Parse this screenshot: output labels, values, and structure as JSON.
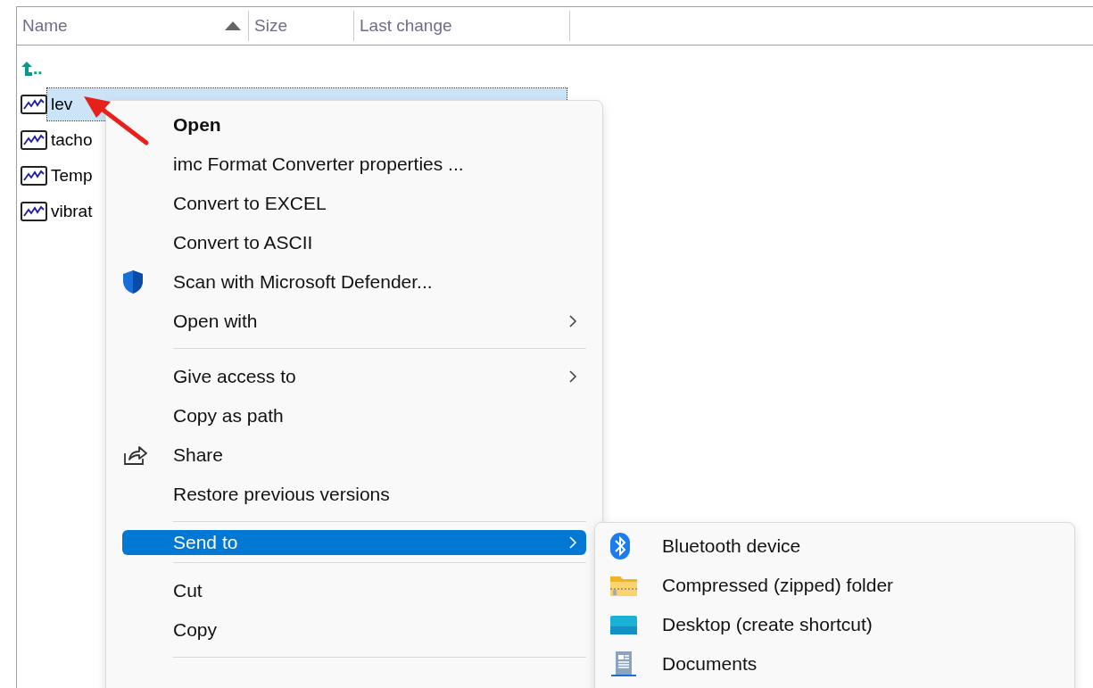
{
  "file_list": {
    "columns": [
      {
        "label": "Name",
        "sorted": true
      },
      {
        "label": "Size",
        "sorted": false
      },
      {
        "label": "Last change",
        "sorted": false
      }
    ],
    "rows": [
      {
        "kind": "parent",
        "name": ".."
      },
      {
        "kind": "file",
        "name": "lev",
        "selected": true
      },
      {
        "kind": "file",
        "name": "tacho",
        "selected": false
      },
      {
        "kind": "file",
        "name": "Temp",
        "selected": false
      },
      {
        "kind": "file",
        "name": "vibrat",
        "selected": false
      }
    ]
  },
  "context_menu": {
    "items": [
      {
        "kind": "item",
        "label": "Open",
        "bold": true,
        "submenu": false,
        "selected": false
      },
      {
        "kind": "item",
        "label": "imc Format Converter properties ...",
        "bold": false,
        "submenu": false,
        "selected": false
      },
      {
        "kind": "item",
        "label": "Convert to EXCEL",
        "bold": false,
        "submenu": false,
        "selected": false
      },
      {
        "kind": "item",
        "label": "Convert to ASCII",
        "bold": false,
        "submenu": false,
        "selected": false
      },
      {
        "kind": "item",
        "label": "Scan with Microsoft Defender...",
        "bold": false,
        "submenu": false,
        "selected": false
      },
      {
        "kind": "item",
        "label": "Open with",
        "bold": false,
        "submenu": true,
        "selected": false
      },
      {
        "kind": "separator"
      },
      {
        "kind": "item",
        "label": "Give access to",
        "bold": false,
        "submenu": true,
        "selected": false
      },
      {
        "kind": "item",
        "label": "Copy as path",
        "bold": false,
        "submenu": false,
        "selected": false
      },
      {
        "kind": "item",
        "label": "Share",
        "bold": false,
        "submenu": false,
        "selected": false
      },
      {
        "kind": "item",
        "label": "Restore previous versions",
        "bold": false,
        "submenu": false,
        "selected": false
      },
      {
        "kind": "separator"
      },
      {
        "kind": "item",
        "label": "Send to",
        "bold": false,
        "submenu": true,
        "selected": true
      },
      {
        "kind": "separator"
      },
      {
        "kind": "item",
        "label": "Cut",
        "bold": false,
        "submenu": false,
        "selected": false
      },
      {
        "kind": "item",
        "label": "Copy",
        "bold": false,
        "submenu": false,
        "selected": false
      },
      {
        "kind": "separator"
      }
    ]
  },
  "send_to_menu": {
    "items": [
      {
        "label": "Bluetooth device"
      },
      {
        "label": "Compressed (zipped) folder"
      },
      {
        "label": "Desktop (create shortcut)"
      },
      {
        "label": "Documents"
      }
    ]
  }
}
